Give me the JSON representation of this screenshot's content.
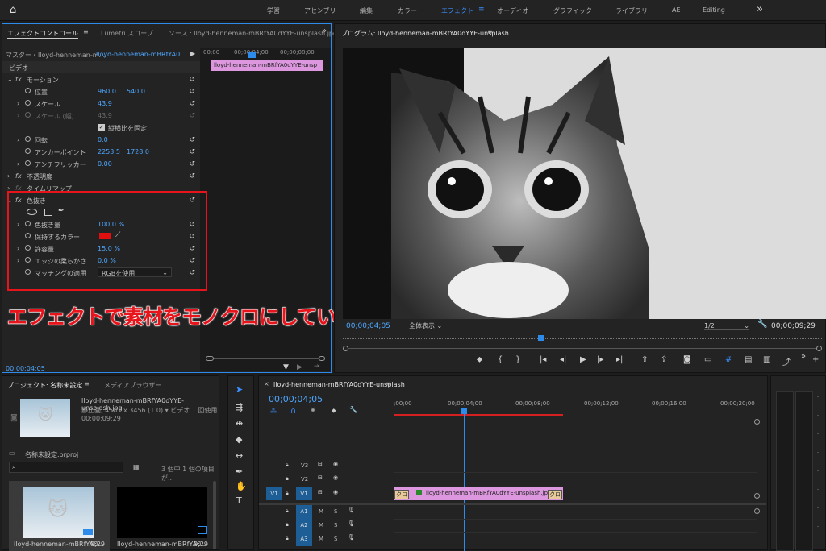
{
  "topbar": {
    "home": "home",
    "workspaces": [
      "学習",
      "アセンブリ",
      "編集",
      "カラー",
      "エフェクト",
      "オーディオ",
      "グラフィック",
      "ライブラリ",
      "AE",
      "Editing"
    ],
    "more": "»"
  },
  "effect_controls": {
    "tabs": [
      "エフェクトコントロール",
      "Lumetri スコープ",
      "ソース : lloyd-henneman-mBRfYA0dYYE-unsplash.jpg"
    ],
    "master": "マスター・lloyd-henneman-m...",
    "master_clip": "lloyd-henneman-mBRfYA0...",
    "ruler": [
      "00;00",
      "00;00;04;00",
      "00;00;08;00"
    ],
    "clip_name": "lloyd-henneman-mBRfYA0dYYE-unsp",
    "video_label": "ビデオ",
    "motion": "モーション",
    "position_label": "位置",
    "position_x": "960.0",
    "position_y": "540.0",
    "scale_label": "スケール",
    "scale_value": "43.9",
    "scale_width_label": "スケール (幅)",
    "scale_width_value": "43.9",
    "uniform_label": "縦横比を固定",
    "rotation_label": "回転",
    "rotation_value": "0.0",
    "anchor_label": "アンカーポイント",
    "anchor_x": "2253.5",
    "anchor_y": "1728.0",
    "antiflicker_label": "アンチフリッカー",
    "antiflicker_value": "0.00",
    "opacity": "不透明度",
    "timeremap": "タイムリマップ",
    "leave_color": "色抜き",
    "amount_label": "色抜き量",
    "amount_value": "100.0 %",
    "keep_color_label": "保持するカラー",
    "tolerance_label": "許容量",
    "tolerance_value": "15.0 %",
    "edge_label": "エッジの柔らかさ",
    "edge_value": "0.0 %",
    "match_label": "マッチングの適用",
    "match_value": "RGBを使用",
    "timecode": "00;00;04;05",
    "keep_color": "#e01010"
  },
  "annotation": {
    "text": "エフェクトで素材をモノクロにしている",
    "color": "#e8141c"
  },
  "program": {
    "title": "プログラム: lloyd-henneman-mBRfYA0dYYE-unsplash",
    "timecode": "00;00;04;05",
    "fit": "全体表示",
    "resolution": "1/2",
    "duration": "00;00;09;29"
  },
  "project": {
    "tabs": [
      "プロジェクト: 名称未設定",
      "メディアブラウザー"
    ],
    "file_name": "lloyd-henneman-mBRfYA0dYYE-unsplash.jpg",
    "file_info1": "静止画, 4507 x 3456 (1.0)  ▾ ビデオ 1 回使用",
    "file_info2": "00;00;09;29",
    "project_file": "名称未設定.prproj",
    "items_count": "3 個中 1 個の項目が...",
    "thumb1_name": "lloyd-henneman-mBRfYA0...",
    "thumb1_dur": "9;29",
    "thumb2_name": "lloyd-henneman-mBRfYA0...",
    "thumb2_dur": "9;29"
  },
  "timeline": {
    "tab": "lloyd-henneman-mBRfYA0dYYE-unsplash",
    "timecode": "00;00;04;05",
    "ruler": [
      ";00;00",
      "00;00;04;00",
      "00;00;08;00",
      "00;00;12;00",
      "00;00;16;00",
      "00;00;20;00"
    ],
    "tracks": [
      "V3",
      "V2",
      "V1",
      "A1",
      "A2",
      "A3"
    ],
    "v1_source": "V1",
    "clip_label": "lloyd-henneman-mBRfYA0dYYE-unsplash.jp",
    "clip_fx_left": "クロ",
    "clip_fx_right": "クロ",
    "m": "M",
    "s": "S"
  }
}
